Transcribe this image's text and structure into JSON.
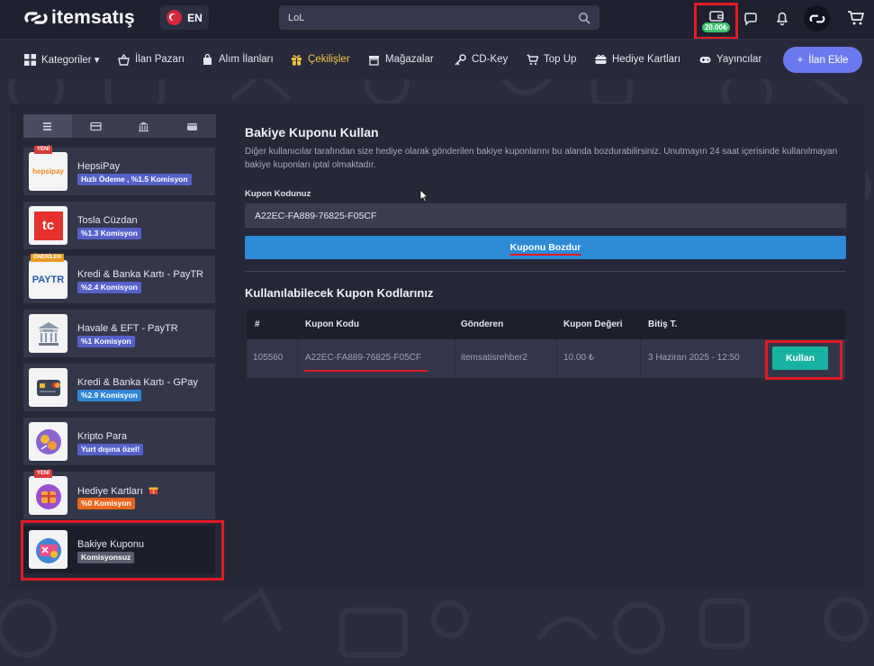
{
  "header": {
    "logo_text": "itemsatış",
    "language": "EN",
    "search": {
      "value": "LoL"
    },
    "wallet_balance": "20.00₺"
  },
  "nav": {
    "items": [
      {
        "label": "Kategoriler ▾",
        "icon": "grid-icon"
      },
      {
        "label": "İlan Pazarı",
        "icon": "basket-icon"
      },
      {
        "label": "Alım İlanları",
        "icon": "bag-icon"
      },
      {
        "label": "Çekilişler",
        "icon": "gift-icon",
        "active": true
      },
      {
        "label": "Mağazalar",
        "icon": "store-icon"
      },
      {
        "label": "CD-Key",
        "icon": "key-icon"
      },
      {
        "label": "Top Up",
        "icon": "cart-icon"
      },
      {
        "label": "Hediye Kartları",
        "icon": "gift-card-icon"
      },
      {
        "label": "Yayıncılar",
        "icon": "gamepad-icon"
      }
    ],
    "add_button": "İlan Ekle"
  },
  "sidebar": {
    "methods": [
      {
        "name": "HepsiPay",
        "badge": "Hızlı Ödeme , %1.5 Komisyon",
        "ribbon": "YENİ",
        "logo_text": "hepsipay"
      },
      {
        "name": "Tosla Cüzdan",
        "badge": "%1.3 Komisyon",
        "logo_text": "tc"
      },
      {
        "name": "Kredi & Banka Kartı - PayTR",
        "badge": "%2.4 Komisyon",
        "ribbon": "ÖNERİLEN",
        "logo_text": "PAYTR"
      },
      {
        "name": "Havale & EFT - PayTR",
        "badge": "%1 Komisyon",
        "logo_text": "BANK"
      },
      {
        "name": "Kredi & Banka Kartı - GPay",
        "badge": "%2.9 Komisyon"
      },
      {
        "name": "Kripto Para",
        "badge": "Yurt dışına özel!"
      },
      {
        "name": "Hediye Kartları",
        "badge": "%0 Komisyon",
        "ribbon": "YENİ"
      },
      {
        "name": "Bakiye Kuponu",
        "badge": "Komisyonsuz",
        "selected": true
      }
    ]
  },
  "content": {
    "title": "Bakiye Kuponu Kullan",
    "description": "Diğer kullanıcılar tarafından size hediye olarak gönderilen bakiye kuponlarını bu alanda bozdurabilirsiniz. Unutmayın 24 saat içerisinde kullanılmayan bakiye kuponları iptal olmaktadır.",
    "code_label": "Kupon Kodunuz",
    "code_value": "A22EC-FA889-76825-F05CF",
    "redeem_button": "Kuponu Bozdur",
    "available_title": "Kullanılabilecek Kupon Kodlarınız",
    "table": {
      "headers": [
        "#",
        "Kupon Kodu",
        "Gönderen",
        "Kupon Değeri",
        "Bitiş T."
      ],
      "rows": [
        {
          "id": "105560",
          "code": "A22EC-FA889-76825-F05CF",
          "sender": "itemsatisrehber2",
          "value": "10.00 ₺",
          "expires": "3 Haziran 2025 - 12:50",
          "action": "Kullan"
        }
      ]
    }
  },
  "colors": {
    "accent_blue": "#2c8ad6",
    "accent_teal": "#19b3a3",
    "highlight_red": "#e21b23",
    "active_nav": "#f5c542"
  }
}
